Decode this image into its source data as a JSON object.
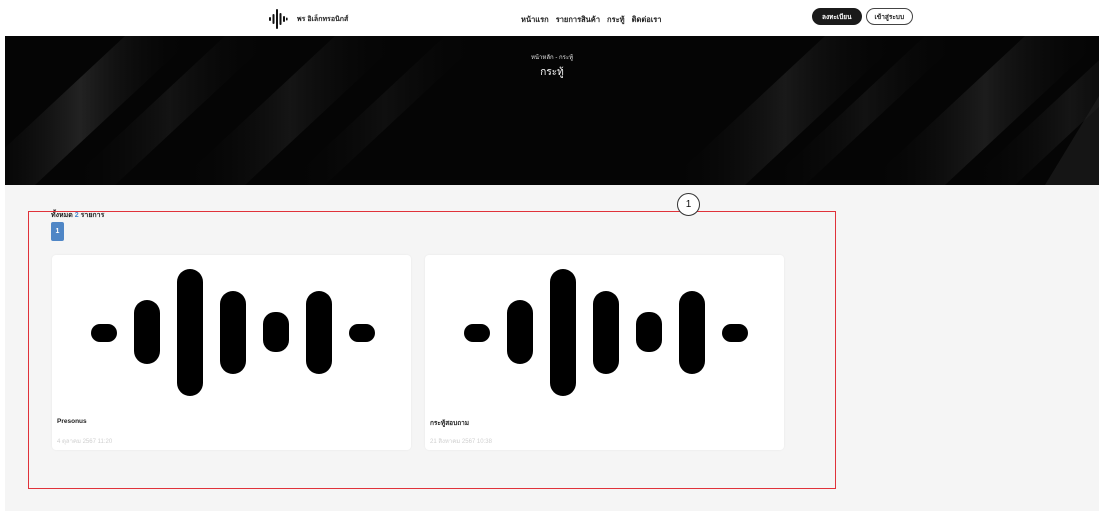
{
  "header": {
    "brand_name": "พร อิเล็กทรอนิกส์",
    "logo_icon": "waveform-logo-icon",
    "nav": [
      "หน้าแรก",
      "รายการสินค้า",
      "กระทู้",
      "ติดต่อเรา"
    ],
    "register_label": "ลงทะเบียน",
    "login_label": "เข้าสู่ระบบ"
  },
  "hero": {
    "breadcrumb": "หน้าหลัก - กระทู้",
    "title": "กระทู้"
  },
  "listing": {
    "count_prefix": "ทั้งหมด",
    "count": "2",
    "count_suffix": "รายการ",
    "current_page": "1"
  },
  "posts": [
    {
      "title": "Presonus",
      "date": "4 ตุลาคม 2567 11:20",
      "image_icon": "waveform-icon"
    },
    {
      "title": "กระทู้สอบถาม",
      "date": "21 สิงหาคม 2567 10:38",
      "image_icon": "waveform-icon"
    }
  ],
  "annotation": {
    "label": "1",
    "color": "#e0323a"
  },
  "colors": {
    "accent": "#4f86c6",
    "dark": "#1b1b1b",
    "hero_bg": "#050505",
    "content_bg": "#f5f5f5"
  }
}
